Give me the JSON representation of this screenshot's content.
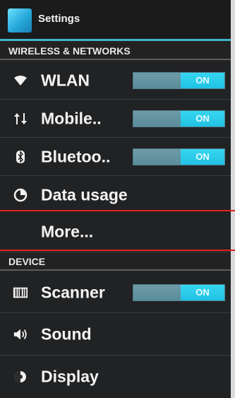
{
  "action_bar": {
    "title": "Settings",
    "icon": "settings-app-icon"
  },
  "sections": {
    "wireless": {
      "header": "WIRELESS & NETWORKS"
    },
    "device": {
      "header": "DEVICE"
    }
  },
  "rows": {
    "wlan": {
      "label": "WLAN",
      "icon": "wifi-icon",
      "toggle": "ON"
    },
    "mobile": {
      "label": "Mobile..",
      "icon": "mobile-data-icon",
      "toggle": "ON"
    },
    "bluetooth": {
      "label": "Bluetoo..",
      "icon": "bluetooth-icon",
      "toggle": "ON"
    },
    "data_usage": {
      "label": "Data usage",
      "icon": "data-usage-icon"
    },
    "more": {
      "label": "More..."
    },
    "scanner": {
      "label": "Scanner",
      "icon": "scanner-icon",
      "toggle": "ON"
    },
    "sound": {
      "label": "Sound",
      "icon": "sound-icon"
    },
    "display": {
      "label": "Display",
      "icon": "display-icon"
    }
  },
  "colors": {
    "accent": "#3fb6c9",
    "toggle_on": "#20c1e3",
    "annotation": "#e32020"
  }
}
